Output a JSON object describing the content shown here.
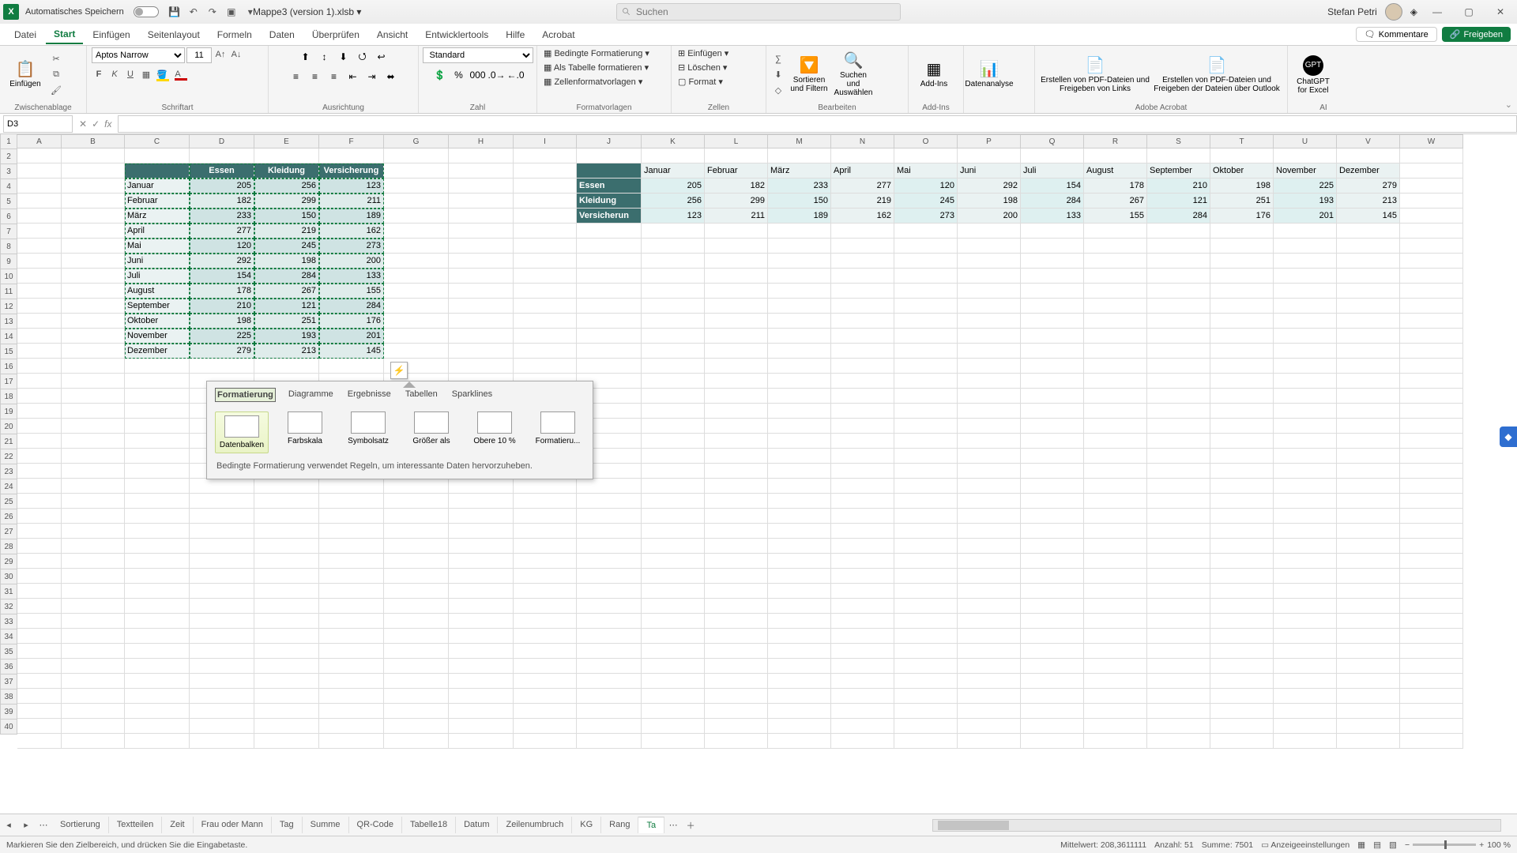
{
  "titlebar": {
    "autoSave": "Automatisches Speichern",
    "filename": "Mappe3 (version 1).xlsb",
    "searchPlaceholder": "Suchen",
    "user": "Stefan Petri"
  },
  "tabs": [
    "Datei",
    "Start",
    "Einfügen",
    "Seitenlayout",
    "Formeln",
    "Daten",
    "Überprüfen",
    "Ansicht",
    "Entwicklertools",
    "Hilfe",
    "Acrobat"
  ],
  "activeTab": 1,
  "rightPills": {
    "comments": "Kommentare",
    "share": "Freigeben"
  },
  "ribbon": {
    "clipboard": {
      "paste": "Einfügen",
      "label": "Zwischenablage"
    },
    "font": {
      "name": "Aptos Narrow",
      "size": "11",
      "label": "Schriftart"
    },
    "align": {
      "label": "Ausrichtung"
    },
    "number": {
      "format": "Standard",
      "label": "Zahl"
    },
    "styles": {
      "cond": "Bedingte Formatierung",
      "asTable": "Als Tabelle formatieren",
      "cellStyles": "Zellenformatvorlagen",
      "label": "Formatvorlagen"
    },
    "cells": {
      "insert": "Einfügen",
      "delete": "Löschen",
      "format": "Format",
      "label": "Zellen"
    },
    "editing": {
      "sort": "Sortieren und Filtern",
      "find": "Suchen und Auswählen",
      "label": "Bearbeiten"
    },
    "addins": {
      "btn": "Add-Ins",
      "label": "Add-Ins"
    },
    "analysis": {
      "btn": "Datenanalyse"
    },
    "acrobat": {
      "pdf1": "Erstellen von PDF-Dateien und Freigeben von Links",
      "pdf2": "Erstellen von PDF-Dateien und Freigeben der Dateien über Outlook",
      "label": "Adobe Acrobat"
    },
    "gpt": {
      "btn": "ChatGPT for Excel",
      "label": "AI"
    }
  },
  "nameBox": "D3",
  "cols": [
    "A",
    "B",
    "C",
    "D",
    "E",
    "F",
    "G",
    "H",
    "I",
    "J",
    "K",
    "L",
    "M",
    "N",
    "O",
    "P",
    "Q",
    "R",
    "S",
    "T",
    "U",
    "V",
    "W"
  ],
  "table1": {
    "headers": [
      "",
      "Essen",
      "Kleidung",
      "Versicherung"
    ],
    "rows": [
      [
        "Januar",
        205,
        256,
        123
      ],
      [
        "Februar",
        182,
        299,
        211
      ],
      [
        "März",
        233,
        150,
        189
      ],
      [
        "April",
        277,
        219,
        162
      ],
      [
        "Mai",
        120,
        245,
        273
      ],
      [
        "Juni",
        292,
        198,
        200
      ],
      [
        "Juli",
        154,
        284,
        133
      ],
      [
        "August",
        178,
        267,
        155
      ],
      [
        "September",
        210,
        121,
        284
      ],
      [
        "Oktober",
        198,
        251,
        176
      ],
      [
        "November",
        225,
        193,
        201
      ],
      [
        "Dezember",
        279,
        213,
        145
      ]
    ]
  },
  "table2": {
    "headers": [
      "",
      "Januar",
      "Februar",
      "März",
      "April",
      "Mai",
      "Juni",
      "Juli",
      "August",
      "September",
      "Oktober",
      "November",
      "Dezember"
    ],
    "rows": [
      [
        "Essen",
        205,
        182,
        233,
        277,
        120,
        292,
        154,
        178,
        210,
        198,
        225,
        279
      ],
      [
        "Kleidung",
        256,
        299,
        150,
        219,
        245,
        198,
        284,
        267,
        121,
        251,
        193,
        213
      ],
      [
        "Versicherun",
        123,
        211,
        189,
        162,
        273,
        200,
        133,
        155,
        284,
        176,
        201,
        145
      ]
    ]
  },
  "callout": {
    "tabs": [
      "Formatierung",
      "Diagramme",
      "Ergebnisse",
      "Tabellen",
      "Sparklines"
    ],
    "activeTab": 0,
    "options": [
      "Datenbalken",
      "Farbskala",
      "Symbolsatz",
      "Größer als",
      "Obere 10 %",
      "Formatieru..."
    ],
    "hint": "Bedingte Formatierung verwendet Regeln, um interessante Daten hervorzuheben."
  },
  "sheets": [
    "Sortierung",
    "Textteilen",
    "Zeit",
    "Frau oder Mann",
    "Tag",
    "Summe",
    "QR-Code",
    "Tabelle18",
    "Datum",
    "Zeilenumbruch",
    "KG",
    "Rang",
    "Ta"
  ],
  "status": {
    "left": "Markieren Sie den Zielbereich, und drücken Sie die Eingabetaste.",
    "avg": "Mittelwert: 208,3611111",
    "count": "Anzahl: 51",
    "sum": "Summe: 7501",
    "disp": "Anzeigeeinstellungen",
    "zoom": "100 %"
  }
}
